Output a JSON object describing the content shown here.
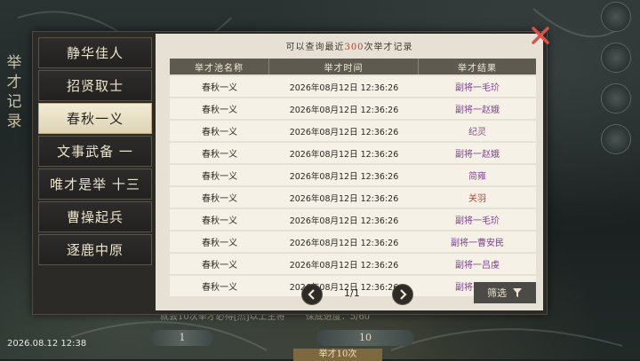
{
  "side_title": "举才记录",
  "hint": {
    "prefix": "可以查询最近",
    "count": "300",
    "suffix": "次举才记录"
  },
  "tabs": [
    {
      "label": "静华佳人",
      "active": false
    },
    {
      "label": "招贤取士",
      "active": false
    },
    {
      "label": "春秋一义",
      "active": true
    },
    {
      "label": "文事武备 一",
      "active": false
    },
    {
      "label": "唯才是举 十三",
      "active": false
    },
    {
      "label": "曹操起兵",
      "active": false
    },
    {
      "label": "逐鹿中原",
      "active": false
    }
  ],
  "table": {
    "headers": [
      "举才池名称",
      "举才时间",
      "举才结果"
    ],
    "rows": [
      {
        "pool": "春秋一义",
        "time": "2026年08月12日 12:36:26",
        "result": "副将一毛玠"
      },
      {
        "pool": "春秋一义",
        "time": "2026年08月12日 12:36:26",
        "result": "副将一赵娥"
      },
      {
        "pool": "春秋一义",
        "time": "2026年08月12日 12:36:26",
        "result": "纪灵"
      },
      {
        "pool": "春秋一义",
        "time": "2026年08月12日 12:36:26",
        "result": "副将一赵娥"
      },
      {
        "pool": "春秋一义",
        "time": "2026年08月12日 12:36:26",
        "result": "简雍"
      },
      {
        "pool": "春秋一义",
        "time": "2026年08月12日 12:36:26",
        "result": "关羽"
      },
      {
        "pool": "春秋一义",
        "time": "2026年08月12日 12:36:26",
        "result": "副将一毛玠"
      },
      {
        "pool": "春秋一义",
        "time": "2026年08月12日 12:36:26",
        "result": "副将一曹安民"
      },
      {
        "pool": "春秋一义",
        "time": "2026年08月12日 12:36:26",
        "result": "副将一吕虔"
      },
      {
        "pool": "春秋一义",
        "time": "2026年08月12日 12:36:26",
        "result": "副将一赵娥"
      }
    ]
  },
  "pager": {
    "text": "1/1",
    "filter_label": "筛选"
  },
  "bottom": {
    "strip_left": "就会10次举才必得[杰]以上主将",
    "strip_right": "保底进度：5/60",
    "pill_left": "1",
    "pill_right": "10",
    "banner": "举才10次"
  },
  "timestamp": "2026.08.12 12:38",
  "colors": {
    "accent_red": "#c23b2a",
    "rare_purple": "#7e3f8f",
    "panel_bg": "#e6e1d4"
  },
  "icons": [
    "close-icon",
    "prev-page-icon",
    "next-page-icon",
    "filter-icon"
  ]
}
